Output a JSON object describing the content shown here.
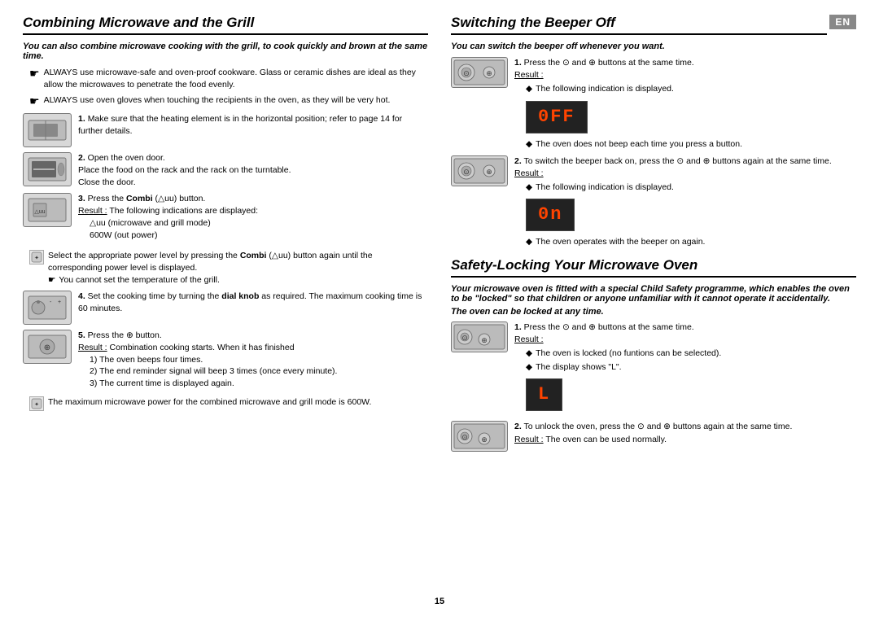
{
  "left_section": {
    "title": "Combining Microwave and the Grill",
    "subtitle": "You can also combine microwave cooking with the grill, to cook quickly and brown at the same time.",
    "bullets": [
      "ALWAYS use microwave-safe and oven-proof cookware. Glass or ceramic dishes are ideal as they allow the microwaves to penetrate the food evenly.",
      "ALWAYS use oven gloves when touching the recipients in the oven, as they will be very hot."
    ],
    "steps": [
      {
        "num": "1.",
        "text": "Make sure that the heating element is in the horizontal position; refer to page 14 for further details.",
        "img": "heating-element"
      },
      {
        "num": "2.",
        "text": "Open the oven door.\nPlace the food on the rack and the rack on the turntable.\nClose the door.",
        "img": "oven-rack"
      },
      {
        "num": "3.",
        "text": "Press the Combi (△uu) button.",
        "result_label": "Result :",
        "result_text": "The following indications are displayed:\n△uu (microwave and grill mode)\n600W (out power)",
        "img": "combi-button",
        "sub_note": "Select the appropriate power level by pressing the Combi (△uu) button again until the corresponding power level is displayed.\nYou cannot set the temperature of the grill."
      },
      {
        "num": "4.",
        "text": "Set the cooking time by turning the dial knob as required. The maximum cooking time is 60 minutes.",
        "img": "dial-knob"
      },
      {
        "num": "5.",
        "text": "Press the ⊕ button.",
        "result_label": "Result :",
        "result_text": "Combination cooking starts. When it has finished\n1) The oven beeps four times.\n2) The end reminder signal will beep 3 times (once every minute).\n3) The current time is displayed again.",
        "img": "start-button"
      }
    ],
    "bottom_note": "The maximum microwave power for the combined microwave and grill mode is 600W."
  },
  "right_section": {
    "section1": {
      "title": "Switching the Beeper Off",
      "subtitle": "You can switch the beeper off whenever you want.",
      "steps": [
        {
          "num": "1.",
          "text": "Press the ⊙ and ⊕ buttons at the same time.",
          "result_label": "Result :",
          "result_bullets": [
            "The following indication is displayed.",
            "The oven does not beep each time you press a button."
          ],
          "display": "0FF",
          "img": "beeper-buttons"
        },
        {
          "num": "2.",
          "text": "To switch the beeper back on, press the ⊙ and ⊕ buttons again at the same time.",
          "result_label": "Result :",
          "result_bullets": [
            "The following indication is displayed.",
            "The oven operates with the beeper on again."
          ],
          "display": "0n",
          "img": "beeper-buttons2"
        }
      ]
    },
    "section2": {
      "title": "Safety-Locking Your Microwave Oven",
      "subtitle": "Your microwave oven is fitted with a special Child Safety programme, which enables the oven to be \"locked\" so that children or anyone unfamiliar with it cannot operate it accidentally.",
      "subtitle2": "The oven can be locked at any time.",
      "steps": [
        {
          "num": "1.",
          "text": "Press the ⊙ and ⊕ buttons at the same time.",
          "result_label": "Result :",
          "result_bullets": [
            "The oven is locked (no funtions can be selected).",
            "The display shows \"L\"."
          ],
          "display": "L",
          "img": "lock-buttons"
        },
        {
          "num": "2.",
          "text": "To unlock the oven, press the ⊙ and ⊕ buttons again at the same time.",
          "result_label": "Result :",
          "result_text": "The oven can be used normally.",
          "img": "unlock-buttons"
        }
      ]
    }
  },
  "page_number": "15",
  "en_badge": "EN"
}
